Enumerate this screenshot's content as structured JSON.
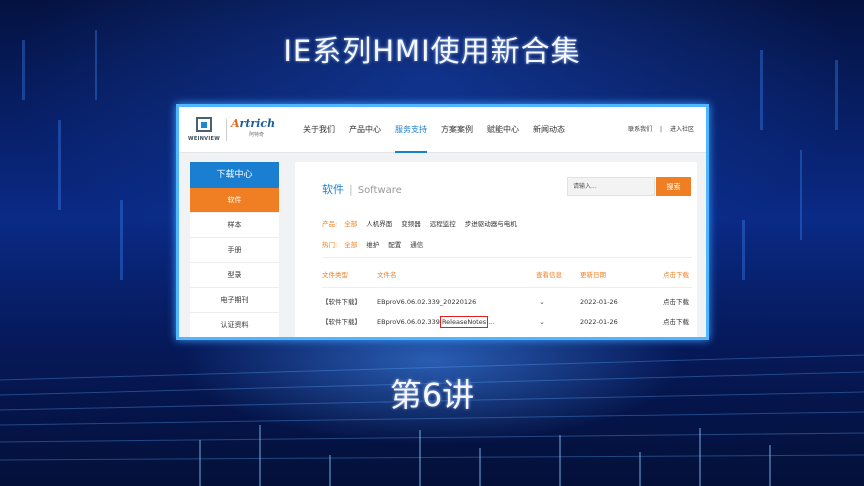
{
  "slide": {
    "title": "IE系列HMI使用新合集",
    "subtitle": "第6讲"
  },
  "website": {
    "logo_left": {
      "icon": "weinview-logo-icon",
      "text": "WEINVIEW"
    },
    "logo_right": {
      "name_a": "A",
      "name_b": "rtrich",
      "sub": "阿特奇"
    },
    "nav": [
      {
        "label": "关于我们"
      },
      {
        "label": "产品中心"
      },
      {
        "label": "服务支持"
      },
      {
        "label": "方案案例"
      },
      {
        "label": "赋能中心"
      },
      {
        "label": "新闻动态"
      }
    ],
    "active_nav": "服务支持",
    "header_right": {
      "contact": "联系我们",
      "separator": "|",
      "community": "进入社区"
    },
    "sidebar": {
      "title": "下载中心",
      "items": [
        {
          "label": "软件"
        },
        {
          "label": "样本"
        },
        {
          "label": "手册"
        },
        {
          "label": "型录"
        },
        {
          "label": "电子期刊"
        },
        {
          "label": "认证资料"
        }
      ]
    },
    "content": {
      "title_cn": "软件",
      "title_sep": "|",
      "title_en": "Software",
      "search_placeholder": "请输入...",
      "search_button": "搜索",
      "filter_product": {
        "label": "产品:",
        "options": [
          "全部",
          "人机界面",
          "变频器",
          "远程监控",
          "步进驱动器与电机"
        ]
      },
      "filter_hot": {
        "label": "热门:",
        "options": [
          "全部",
          "维护",
          "配置",
          "通信"
        ]
      },
      "table": {
        "headers": [
          "文件类型",
          "文件名",
          "查看信息",
          "更新日期",
          "点击下载"
        ],
        "rows": [
          {
            "type": "【软件下载】",
            "name": "EBproV6.06.02.339_20220126",
            "name_hl": "",
            "name_tail": "",
            "info": "⌄",
            "date": "2022-01-26",
            "action": "点击下载"
          },
          {
            "type": "【软件下载】",
            "name": "EBproV6.06.02.339",
            "name_hl": "ReleaseNotes",
            "name_tail": "...",
            "info": "⌄",
            "date": "2022-01-26",
            "action": "点击下载"
          }
        ]
      }
    }
  },
  "colors": {
    "accent_blue": "#1a7fd0",
    "accent_orange": "#ef7f22",
    "highlight_red": "#e01f1f",
    "frame_cyan": "#4fb6ff"
  }
}
